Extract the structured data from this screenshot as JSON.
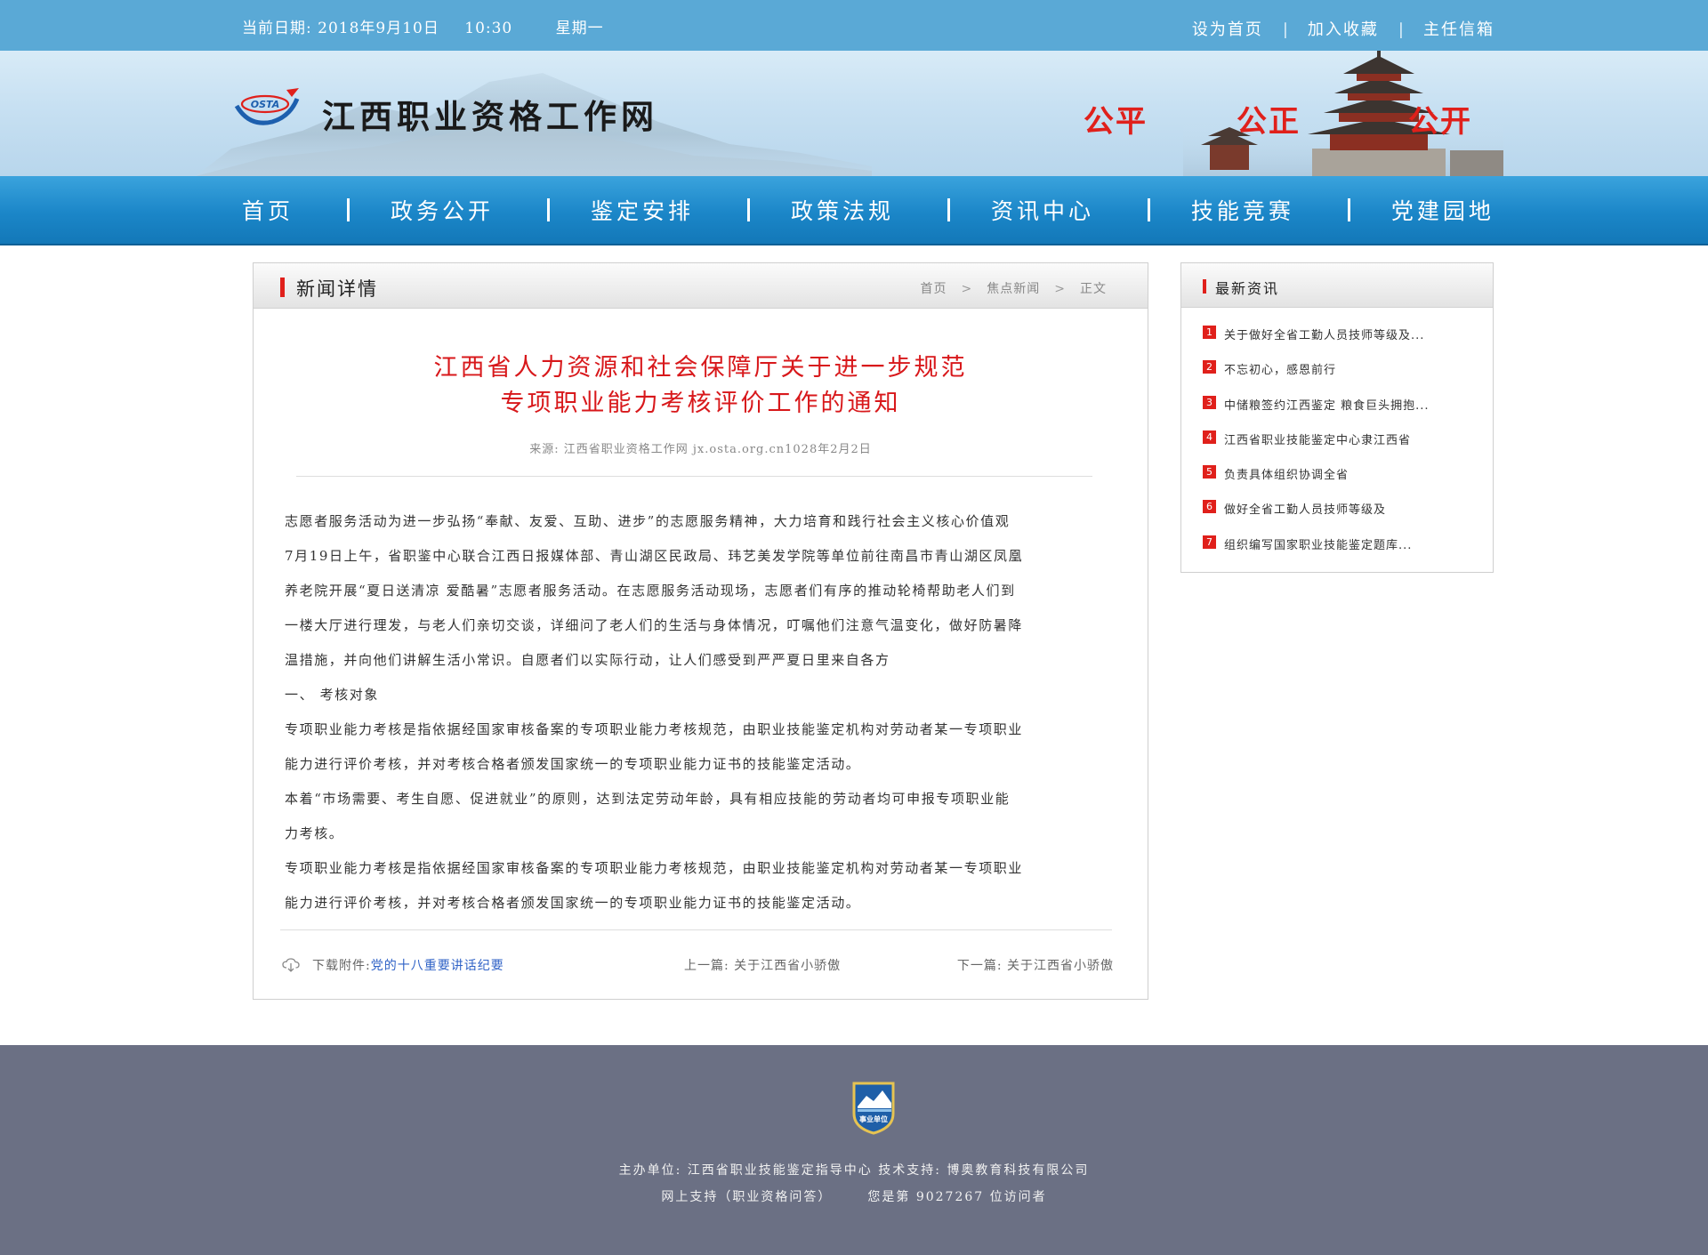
{
  "topbar": {
    "date_label": "当前日期: 2018年9月10日",
    "time": "10:30",
    "weekday": "星期一",
    "links": [
      "设为首页",
      "加入收藏",
      "主任信箱"
    ],
    "separator": "|"
  },
  "banner": {
    "logo_text": "OSTA",
    "site_title": "江西职业资格工作网",
    "slogans": [
      "公平",
      "公正",
      "公开"
    ]
  },
  "nav": {
    "items": [
      "首页",
      "政务公开",
      "鉴定安排",
      "政策法规",
      "资讯中心",
      "技能竞赛",
      "党建园地"
    ]
  },
  "article_panel": {
    "header_title": "新闻详情",
    "breadcrumb": [
      "首页",
      "焦点新闻",
      "正文"
    ],
    "breadcrumb_separator": ">",
    "title_line1": "江西省人力资源和社会保障厅关于进一步规范",
    "title_line2": "专项职业能力考核评价工作的通知",
    "source": "来源: 江西省职业资格工作网 jx.osta.org.cn1028年2月2日",
    "paragraphs": [
      "志愿者服务活动为进一步弘扬“奉献、友爱、互助、进步”的志愿服务精神，大力培育和践行社会主义核心价值观",
      "7月19日上午，省职鉴中心联合江西日报媒体部、青山湖区民政局、玮艺美发学院等单位前往南昌市青山湖区凤凰",
      "养老院开展“夏日送清凉 爱酷暑”志愿者服务活动。在志愿服务活动现场，志愿者们有序的推动轮椅帮助老人们到",
      "一楼大厅进行理发，与老人们亲切交谈，详细问了老人们的生活与身体情况，叮嘱他们注意气温变化，做好防暑降",
      "温措施，并向他们讲解生活小常识。自愿者们以实际行动，让人们感受到严严夏日里来自各方",
      "一、  考核对象",
      "专项职业能力考核是指依据经国家审核备案的专项职业能力考核规范，由职业技能鉴定机构对劳动者某一专项职业",
      "能力进行评价考核，并对考核合格者颁发国家统一的专项职业能力证书的技能鉴定活动。",
      "本着“市场需要、考生自愿、促进就业”的原则，达到法定劳动年龄，具有相应技能的劳动者均可申报专项职业能",
      "力考核。",
      "专项职业能力考核是指依据经国家审核备案的专项职业能力考核规范，由职业技能鉴定机构对劳动者某一专项职业",
      "能力进行评价考核，并对考核合格者颁发国家统一的专项职业能力证书的技能鉴定活动。"
    ],
    "download_label": "下载附件:",
    "download_link": "党的十八重要讲话纪要",
    "prev": "上一篇: 关于江西省小骄傲",
    "next": "下一篇: 关于江西省小骄傲"
  },
  "side_panel": {
    "header_title": "最新资讯",
    "items": [
      {
        "num": "1",
        "text": "关于做好全省工勤人员技师等级及..."
      },
      {
        "num": "2",
        "text": "不忘初心，感恩前行"
      },
      {
        "num": "3",
        "text": "中储粮签约江西鉴定 粮食巨头拥抱..."
      },
      {
        "num": "4",
        "text": "江西省职业技能鉴定中心隶江西省"
      },
      {
        "num": "5",
        "text": "负责具体组织协调全省"
      },
      {
        "num": "6",
        "text": "做好全省工勤人员技师等级及"
      },
      {
        "num": "7",
        "text": "组织编写国家职业技能鉴定题库..."
      }
    ]
  },
  "footer": {
    "badge_text": "事业单位",
    "line1": "主办单位: 江西省职业技能鉴定指导中心 技术支持: 博奥教育科技有限公司",
    "support": "网上支持（职业资格问答）",
    "visitor_prefix": "您是第",
    "visitor_count": "9027267",
    "visitor_suffix": "位访问者"
  },
  "colors": {
    "topbar": "#5aa9d6",
    "nav": "#1b86c8",
    "accent_red": "#e0201b",
    "title_red": "#d8181b",
    "link_blue": "#2f62c6",
    "footer": "#6b7084"
  }
}
